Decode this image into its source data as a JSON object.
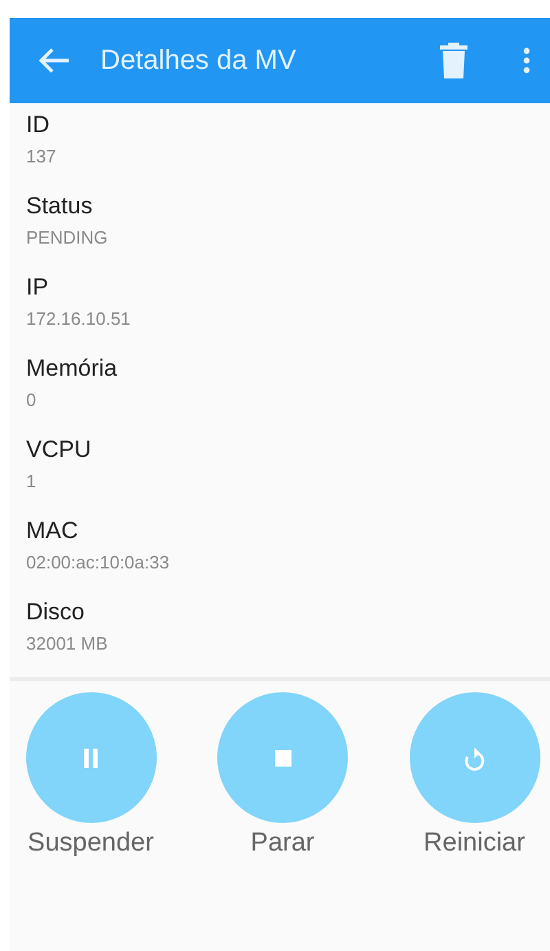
{
  "app_bar": {
    "title": "Detalhes da MV"
  },
  "fields": [
    {
      "label": "ID",
      "value": "137"
    },
    {
      "label": "Status",
      "value": "PENDING"
    },
    {
      "label": "IP",
      "value": "172.16.10.51"
    },
    {
      "label": "Memória",
      "value": "0"
    },
    {
      "label": "VCPU",
      "value": "1"
    },
    {
      "label": "MAC",
      "value": "02:00:ac:10:0a:33"
    },
    {
      "label": "Disco",
      "value": "32001 MB"
    }
  ],
  "actions": [
    {
      "kind": "pause",
      "label": "Suspender"
    },
    {
      "kind": "stop",
      "label": "Parar"
    },
    {
      "kind": "restart",
      "label": "Reiniciar"
    }
  ]
}
